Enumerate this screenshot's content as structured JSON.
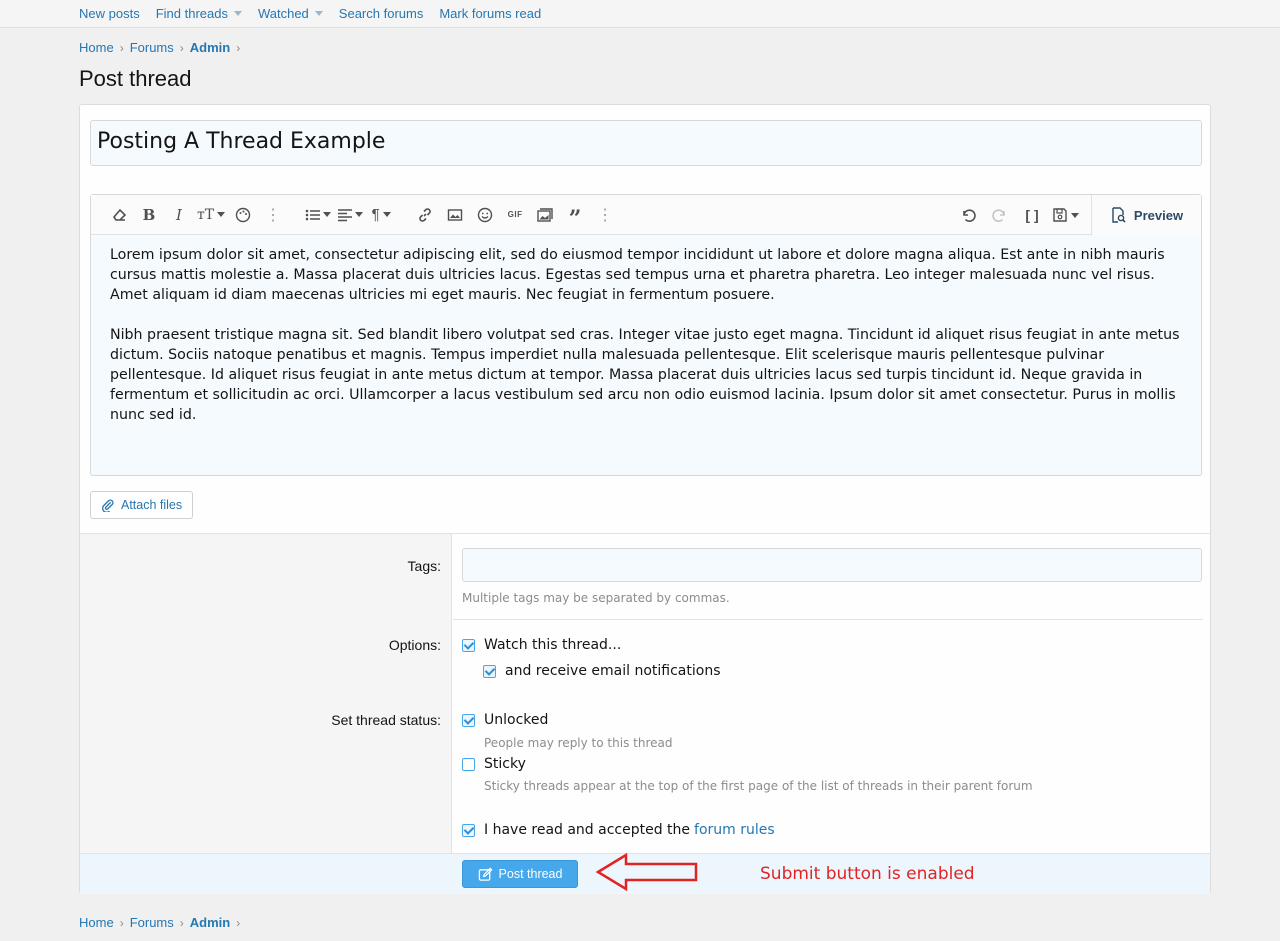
{
  "subnav": {
    "items": [
      {
        "label": "New posts",
        "dropdown": false
      },
      {
        "label": "Find threads",
        "dropdown": true
      },
      {
        "label": "Watched",
        "dropdown": true
      },
      {
        "label": "Search forums",
        "dropdown": false
      },
      {
        "label": "Mark forums read",
        "dropdown": false
      }
    ]
  },
  "breadcrumb": {
    "home": "Home",
    "forums": "Forums",
    "admin": "Admin"
  },
  "page_title": "Post thread",
  "thread_title_value": "Posting A Thread Example",
  "editor": {
    "preview_label": "Preview",
    "paragraphs": [
      "Lorem ipsum dolor sit amet, consectetur adipiscing elit, sed do eiusmod tempor incididunt ut labore et dolore magna aliqua. Est ante in nibh mauris cursus mattis molestie a. Massa placerat duis ultricies lacus. Egestas sed tempus urna et pharetra pharetra. Leo integer malesuada nunc vel risus. Amet aliquam id diam maecenas ultricies mi eget mauris. Nec feugiat in fermentum posuere.",
      "Nibh praesent tristique magna sit. Sed blandit libero volutpat sed cras. Integer vitae justo eget magna. Tincidunt id aliquet risus feugiat in ante metus dictum. Sociis natoque penatibus et magnis. Tempus imperdiet nulla malesuada pellentesque. Elit scelerisque mauris pellentesque pulvinar pellentesque. Id aliquet risus feugiat in ante metus dictum at tempor. Massa placerat duis ultricies lacus sed turpis tincidunt id. Neque gravida in fermentum et sollicitudin ac orci. Ullamcorper a lacus vestibulum sed arcu non odio euismod lacinia. Ipsum dolor sit amet consectetur. Purus in mollis nunc sed id."
    ]
  },
  "attach_label": "Attach files",
  "form": {
    "tags_label": "Tags:",
    "tags_value": "",
    "tags_hint": "Multiple tags may be separated by commas.",
    "options_label": "Options:",
    "watch_label": "Watch this thread...",
    "email_label": "and receive email notifications",
    "status_label": "Set thread status:",
    "unlocked_label": "Unlocked",
    "unlocked_hint": "People may reply to this thread",
    "sticky_label": "Sticky",
    "sticky_hint": "Sticky threads appear at the top of the first page of the list of threads in their parent forum",
    "rules_prefix": "I have read and accepted the",
    "rules_link": "forum rules",
    "watch_checked": true,
    "email_checked": true,
    "unlocked_checked": true,
    "sticky_checked": false,
    "rules_checked": true
  },
  "submit_label": "Post thread",
  "annotation_text": "Submit button is enabled",
  "colors": {
    "accent": "#47a7eb",
    "link": "#2577b1",
    "annotation": "#e02424"
  }
}
